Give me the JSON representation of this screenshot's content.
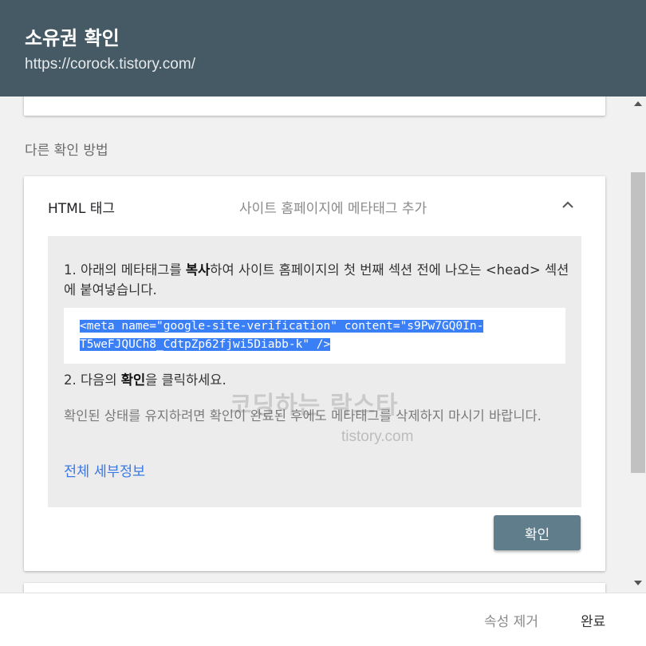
{
  "header": {
    "title": "소유권 확인",
    "url": "https://corock.tistory.com/"
  },
  "section_label": "다른 확인 방법",
  "card": {
    "title": "HTML 태그",
    "subtitle": "사이트 홈페이지에 메타태그 추가",
    "step1": {
      "prefix": "1. 아래의 메타태그를 ",
      "bold": "복사",
      "suffix": "하여 사이트 홈페이지의 첫 번째 섹션 전에 나오는 <head> 섹션에 붙여넣습니다."
    },
    "meta_tag": "<meta name=\"google-site-verification\" content=\"s9Pw7GQ0In-T5weFJQUCh8_CdtpZp62fjwi5Diabb-k\" />",
    "step2": {
      "prefix": "2. 다음의 ",
      "bold": "확인",
      "suffix": "을 클릭하세요."
    },
    "note": "확인된 상태를 유지하려면 확인이 완료된 후에도 메타태그를 삭제하지 마시기 바랍니다.",
    "details_link": "전체 세부정보",
    "confirm_label": "확인"
  },
  "footer": {
    "remove_label": "속성 제거",
    "done_label": "완료"
  },
  "watermark": {
    "main": "코딩하는 락스타",
    "sub": "tistory.com"
  },
  "colors": {
    "header_bg": "#455a64",
    "button_bg": "#607d8b",
    "link": "#3b78e7",
    "selection": "#3b7ff6"
  }
}
